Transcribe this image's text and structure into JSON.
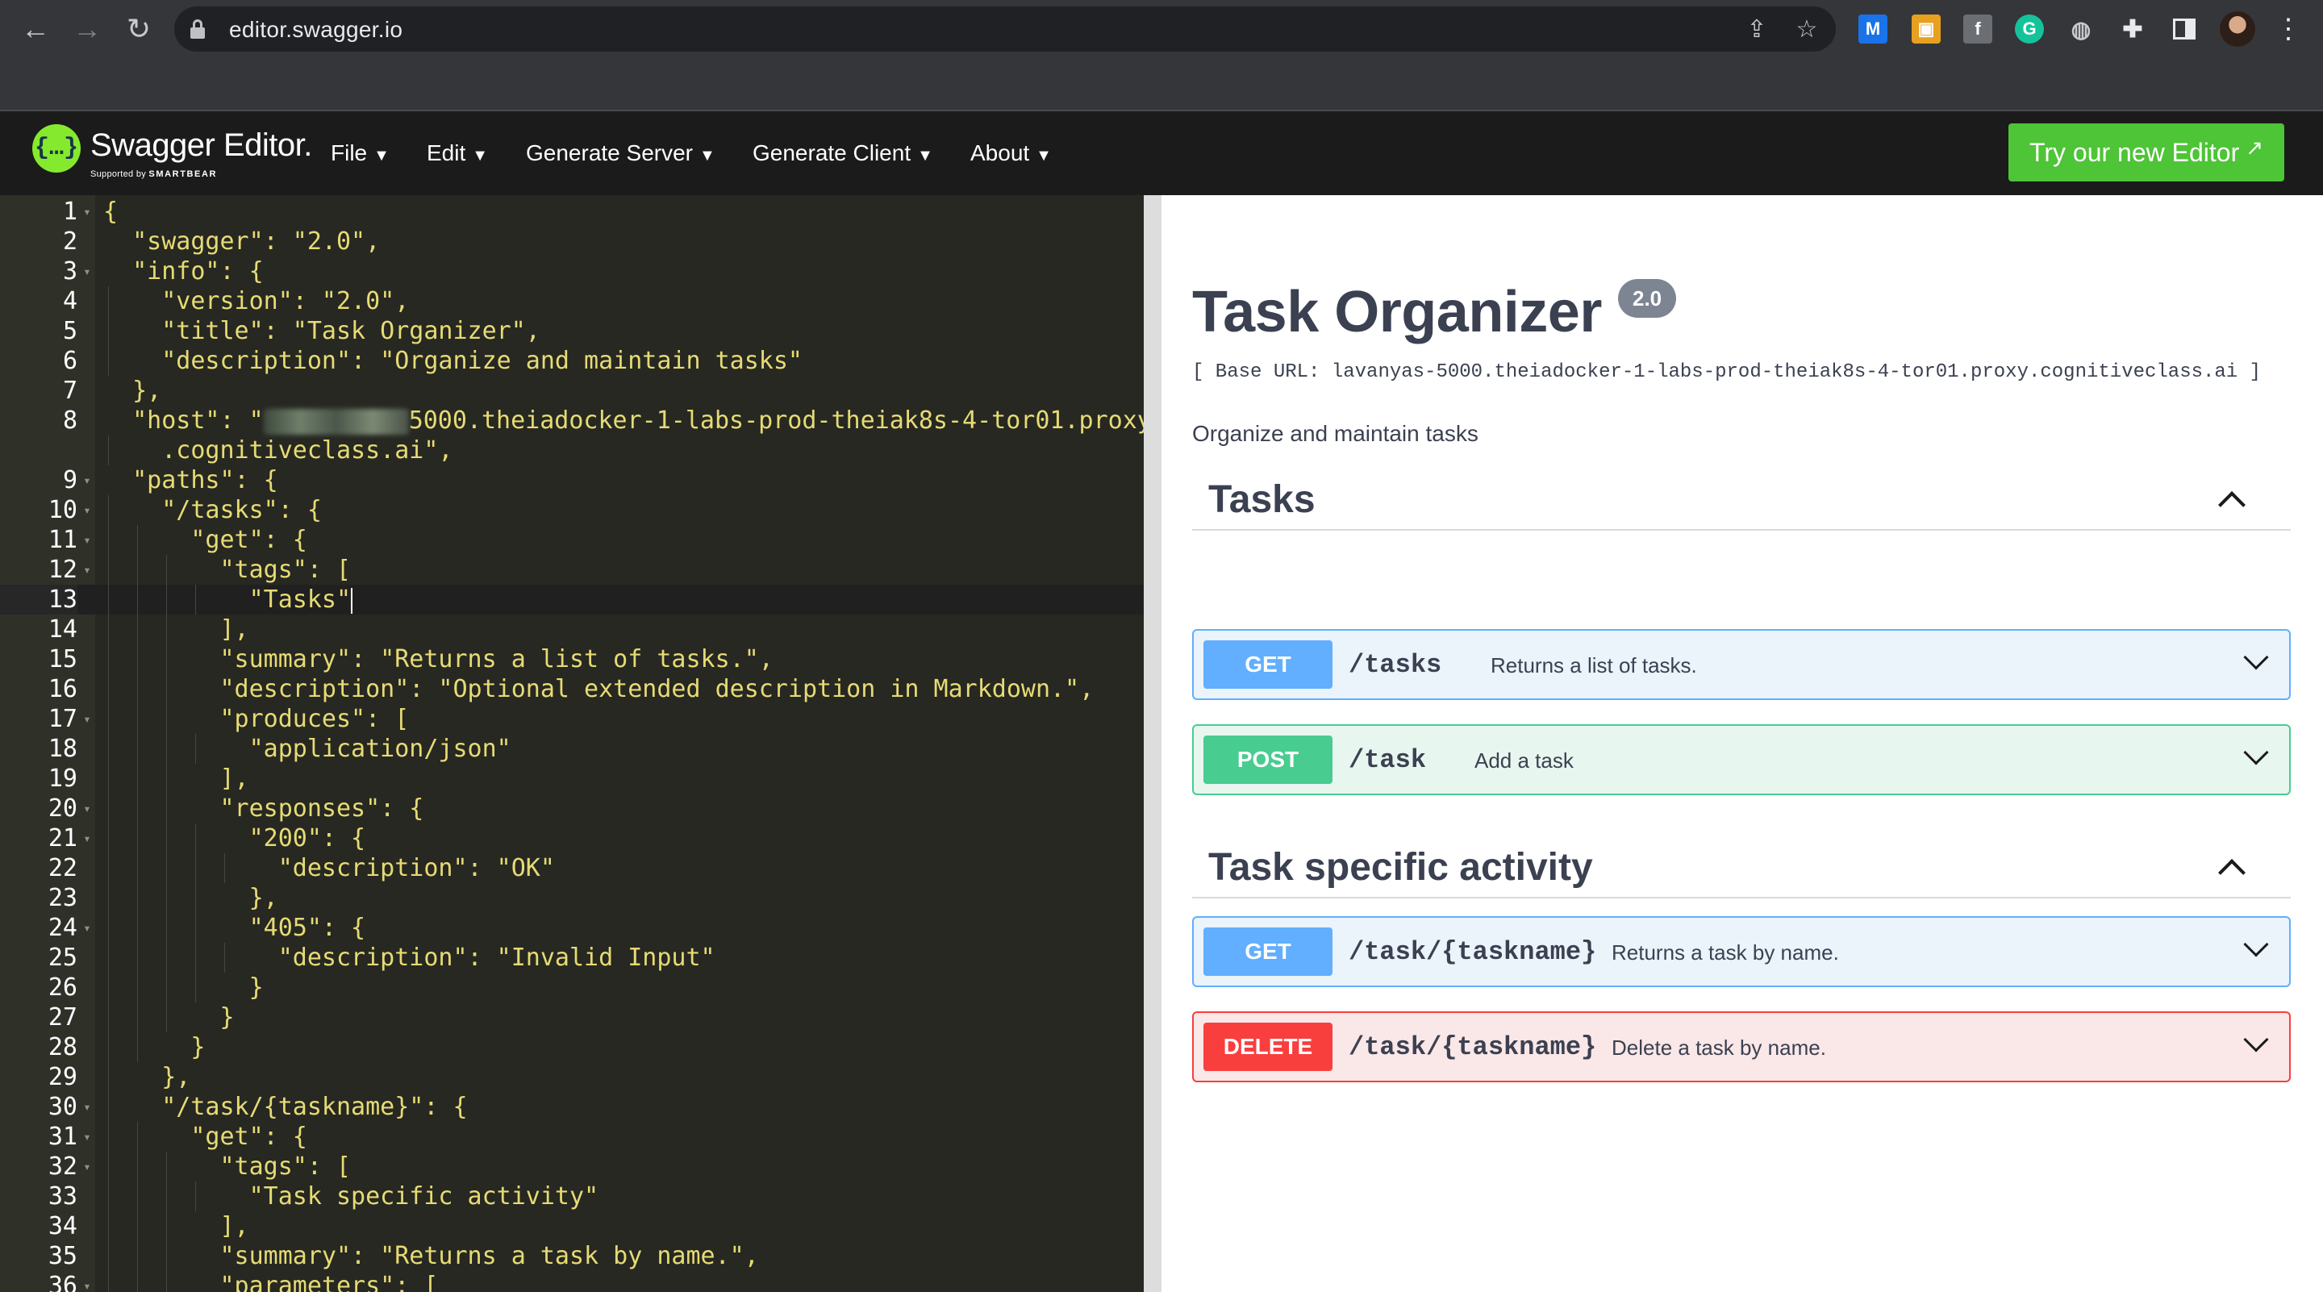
{
  "browser": {
    "url": "editor.swagger.io"
  },
  "topbar": {
    "logo_title": "Swagger Editor.",
    "logo_sub_prefix": "Supported by",
    "logo_sub_brand": "SMARTBEAR",
    "logo_glyph": "{…}",
    "menu": [
      {
        "label": "File"
      },
      {
        "label": "Edit"
      },
      {
        "label": "Generate Server"
      },
      {
        "label": "Generate Client"
      },
      {
        "label": "About"
      }
    ],
    "new_editor_label": "Try our new Editor"
  },
  "editor": {
    "active_line": 13,
    "lines": [
      {
        "n": "1",
        "text": "{"
      },
      {
        "n": "2",
        "text": "  \"swagger\": \"2.0\","
      },
      {
        "n": "3",
        "text": "  \"info\": {"
      },
      {
        "n": "4",
        "text": "    \"version\": \"2.0\","
      },
      {
        "n": "5",
        "text": "    \"title\": \"Task Organizer\","
      },
      {
        "n": "6",
        "text": "    \"description\": \"Organize and maintain tasks\""
      },
      {
        "n": "7",
        "text": "  },"
      },
      {
        "n": "8",
        "text": "  \"host\": \"",
        "host_rest": "5000.theiadocker-1-labs-prod-theiak8s-4-tor01.proxy"
      },
      {
        "n": "",
        "text": "    .cognitiveclass.ai\","
      },
      {
        "n": "9",
        "text": "  \"paths\": {"
      },
      {
        "n": "10",
        "text": "    \"/tasks\": {"
      },
      {
        "n": "11",
        "text": "      \"get\": {"
      },
      {
        "n": "12",
        "text": "        \"tags\": ["
      },
      {
        "n": "13",
        "text": "          \"Tasks\""
      },
      {
        "n": "14",
        "text": "        ],"
      },
      {
        "n": "15",
        "text": "        \"summary\": \"Returns a list of tasks.\","
      },
      {
        "n": "16",
        "text": "        \"description\": \"Optional extended description in Markdown.\","
      },
      {
        "n": "17",
        "text": "        \"produces\": ["
      },
      {
        "n": "18",
        "text": "          \"application/json\""
      },
      {
        "n": "19",
        "text": "        ],"
      },
      {
        "n": "20",
        "text": "        \"responses\": {"
      },
      {
        "n": "21",
        "text": "          \"200\": {"
      },
      {
        "n": "22",
        "text": "            \"description\": \"OK\""
      },
      {
        "n": "23",
        "text": "          },"
      },
      {
        "n": "24",
        "text": "          \"405\": {"
      },
      {
        "n": "25",
        "text": "            \"description\": \"Invalid Input\""
      },
      {
        "n": "26",
        "text": "          }"
      },
      {
        "n": "27",
        "text": "        }"
      },
      {
        "n": "28",
        "text": "      }"
      },
      {
        "n": "29",
        "text": "    },"
      },
      {
        "n": "30",
        "text": "    \"/task/{taskname}\": {"
      },
      {
        "n": "31",
        "text": "      \"get\": {"
      },
      {
        "n": "32",
        "text": "        \"tags\": ["
      },
      {
        "n": "33",
        "text": "          \"Task specific activity\""
      },
      {
        "n": "34",
        "text": "        ],"
      },
      {
        "n": "35",
        "text": "        \"summary\": \"Returns a task by name.\","
      },
      {
        "n": "36",
        "text": "        \"parameters\": ["
      }
    ]
  },
  "preview": {
    "title": "Task Organizer",
    "version": "2.0",
    "base_url": "[ Base URL: lavanyas-5000.theiadocker-1-labs-prod-theiak8s-4-tor01.proxy.cognitiveclass.ai ]",
    "description": "Organize and maintain tasks",
    "tags": [
      {
        "name": "Tasks",
        "operations": [
          {
            "method": "GET",
            "path": "/tasks",
            "summary": "Returns a list of tasks."
          },
          {
            "method": "POST",
            "path": "/task",
            "summary": "Add a task"
          }
        ]
      },
      {
        "name": "Task specific activity",
        "operations": [
          {
            "method": "GET",
            "path": "/task/{taskname}",
            "summary": "Returns a task by name."
          },
          {
            "method": "DELETE",
            "path": "/task/{taskname}",
            "summary": "Delete a task by name."
          }
        ]
      }
    ]
  },
  "colors": {
    "get": "#61affe",
    "post": "#49cc90",
    "delete": "#f93e3e",
    "new_editor_button": "#4ec437",
    "editor_bg": "#272822"
  }
}
